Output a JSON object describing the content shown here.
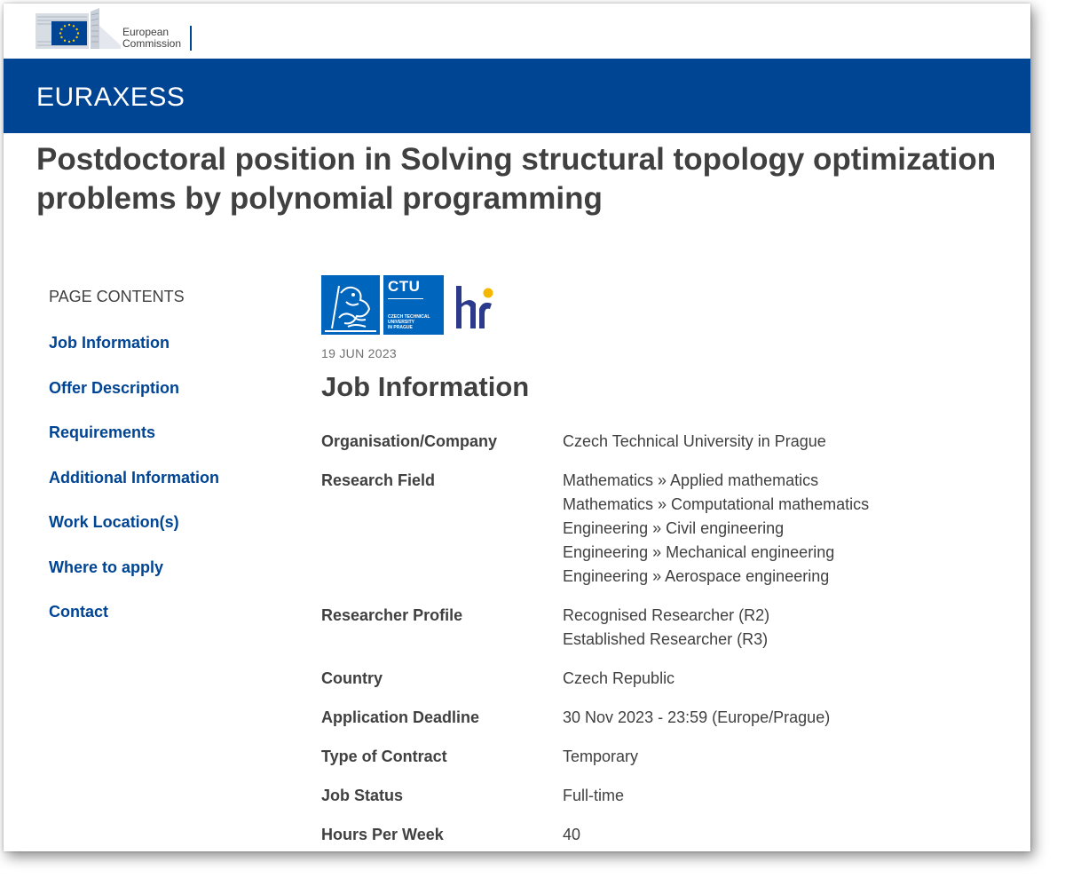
{
  "header": {
    "ec_logo_line1": "European",
    "ec_logo_line2": "Commission",
    "site_name": "EURAXESS"
  },
  "page": {
    "title": "Postdoctoral position in Solving structural topology optimization problems by polynomial programming"
  },
  "toc": {
    "heading": "PAGE CONTENTS",
    "items": [
      "Job Information",
      "Offer Description",
      "Requirements",
      "Additional Information",
      "Work Location(s)",
      "Where to apply",
      "Contact"
    ]
  },
  "logos": {
    "ctu_word": "CTU",
    "ctu_line1": "CZECH TECHNICAL",
    "ctu_line2": "UNIVERSITY",
    "ctu_line3": "IN PRAGUE",
    "hr_logo_text": "hr"
  },
  "job": {
    "date": "19 JUN 2023",
    "section_title": "Job Information",
    "rows": [
      {
        "label": "Organisation/Company",
        "values": [
          "Czech Technical University in Prague"
        ]
      },
      {
        "label": "Research Field",
        "values": [
          "Mathematics » Applied mathematics",
          "Mathematics » Computational mathematics",
          "Engineering » Civil engineering",
          "Engineering » Mechanical engineering",
          "Engineering » Aerospace engineering"
        ]
      },
      {
        "label": "Researcher Profile",
        "values": [
          "Recognised Researcher (R2)",
          "Established Researcher (R3)"
        ]
      },
      {
        "label": "Country",
        "values": [
          "Czech Republic"
        ]
      },
      {
        "label": "Application Deadline",
        "values": [
          "30 Nov 2023 - 23:59 (Europe/Prague)"
        ]
      },
      {
        "label": "Type of Contract",
        "values": [
          "Temporary"
        ]
      },
      {
        "label": "Job Status",
        "values": [
          "Full-time"
        ]
      },
      {
        "label": "Hours Per Week",
        "values": [
          "40"
        ]
      }
    ]
  },
  "colors": {
    "brand_blue": "#004494",
    "ctu_blue": "#0065bd",
    "eu_yellow": "#ffcc00",
    "text": "#404040"
  }
}
